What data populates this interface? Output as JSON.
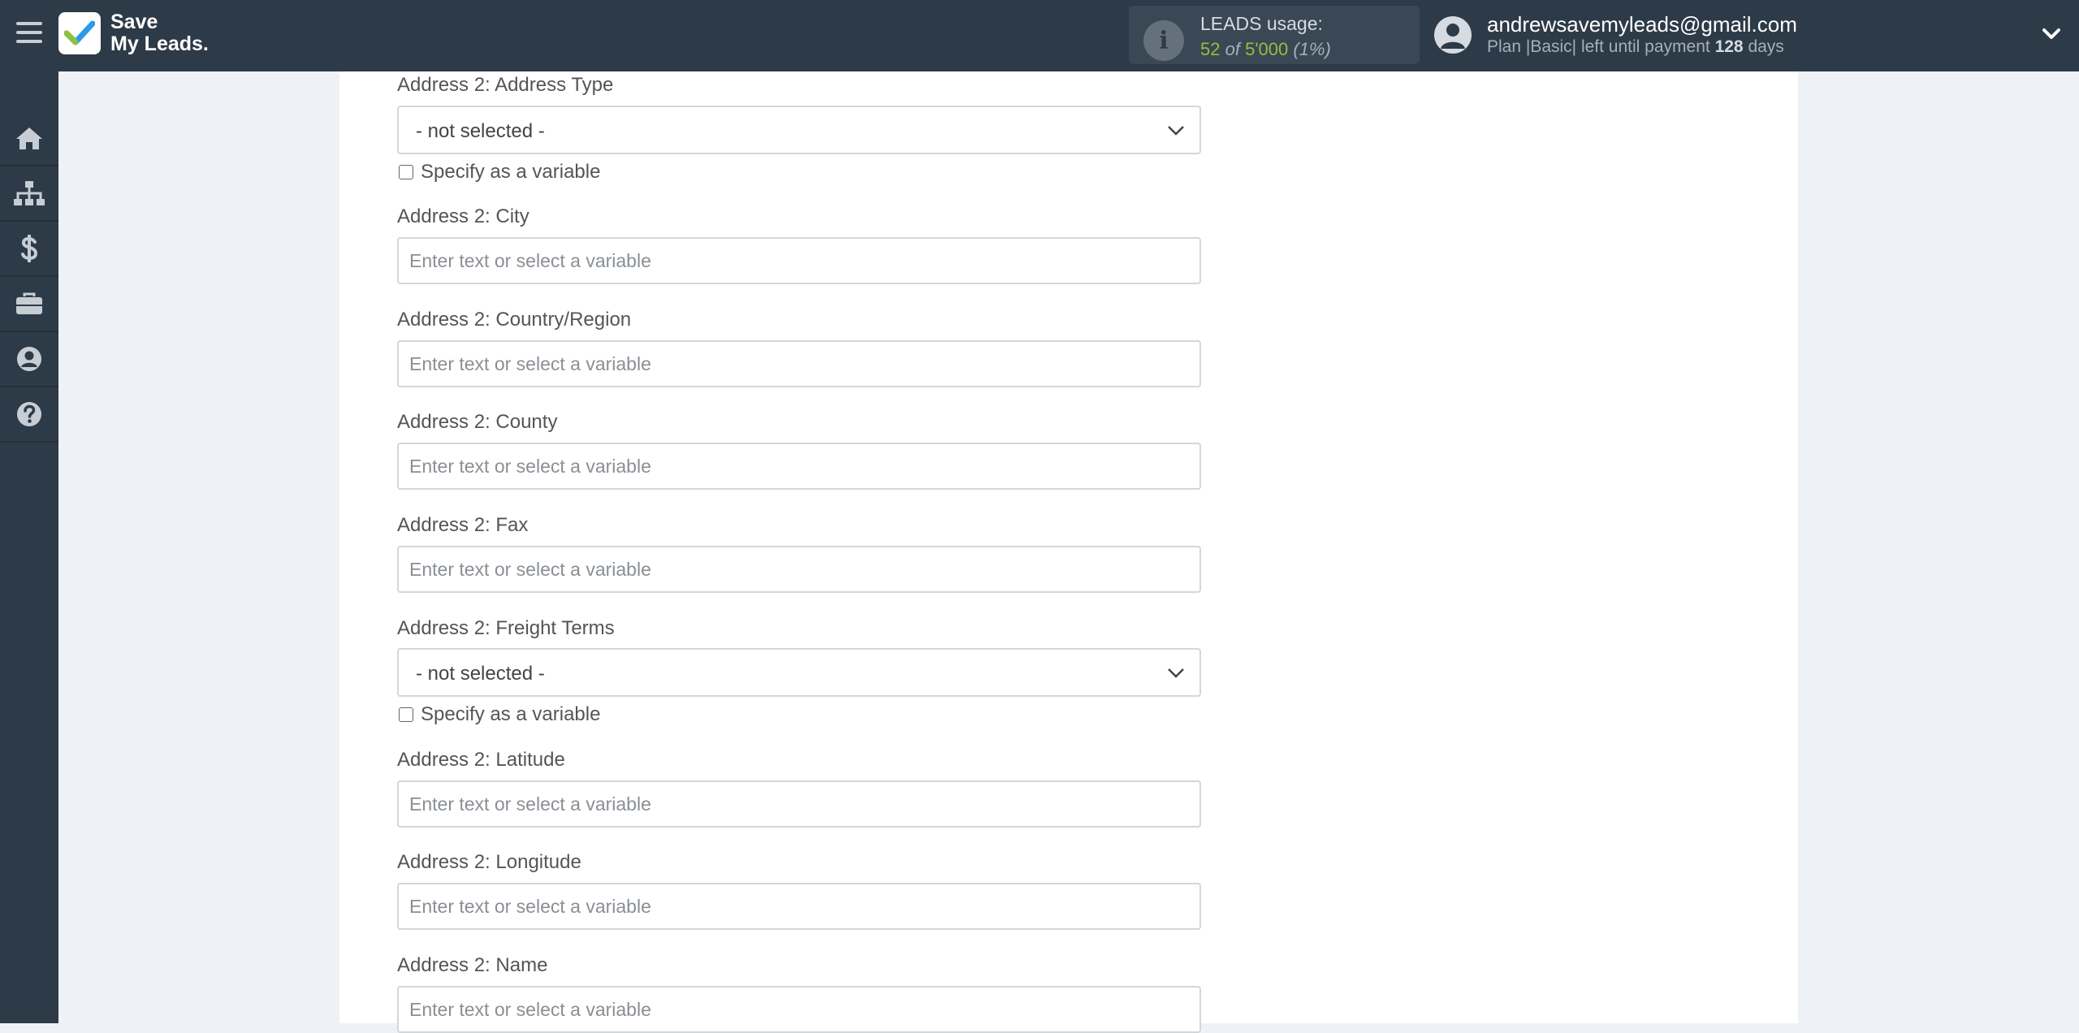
{
  "brand": {
    "name_line1": "Save",
    "name_line2": "My Leads.",
    "icon": "checkmark-logo-icon",
    "accent_green": "#8fc13b",
    "accent_blue": "#2b9be8"
  },
  "header": {
    "leads_usage_label": "LEADS usage:",
    "leads_used": "52",
    "leads_of": "of",
    "leads_total": "5'000",
    "leads_percent": "(1%)",
    "user_email": "andrewsavemyleads@gmail.com",
    "plan_prefix": "Plan |Basic| left until payment",
    "plan_days": "128",
    "plan_days_suffix": "days"
  },
  "sidebar": {
    "items": [
      {
        "icon": "home-icon"
      },
      {
        "icon": "sitemap-icon"
      },
      {
        "icon": "dollar-icon"
      },
      {
        "icon": "briefcase-icon"
      },
      {
        "icon": "user-circle-icon"
      },
      {
        "icon": "question-icon"
      }
    ]
  },
  "form": {
    "address_type": {
      "label": "Address 2: Address Type",
      "value": "- not selected -",
      "checkbox_label": "Specify as a variable"
    },
    "city": {
      "label": "Address 2: City",
      "placeholder": "Enter text or select a variable"
    },
    "country": {
      "label": "Address 2: Country/Region",
      "placeholder": "Enter text or select a variable"
    },
    "county": {
      "label": "Address 2: County",
      "placeholder": "Enter text or select a variable"
    },
    "fax": {
      "label": "Address 2: Fax",
      "placeholder": "Enter text or select a variable"
    },
    "freight_terms": {
      "label": "Address 2: Freight Terms",
      "value": "- not selected -",
      "checkbox_label": "Specify as a variable"
    },
    "latitude": {
      "label": "Address 2: Latitude",
      "placeholder": "Enter text or select a variable"
    },
    "longitude": {
      "label": "Address 2: Longitude",
      "placeholder": "Enter text or select a variable"
    },
    "name": {
      "label": "Address 2: Name",
      "placeholder": "Enter text or select a variable"
    }
  }
}
